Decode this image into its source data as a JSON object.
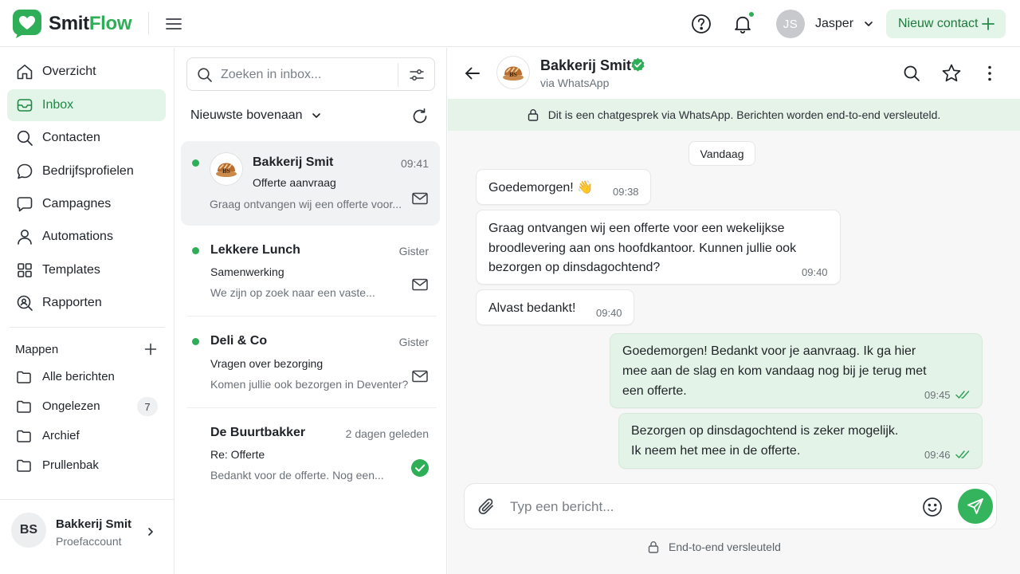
{
  "app": {
    "brand_part1": "Smit",
    "brand_part2": "Flow",
    "brand_color": "#2eae57"
  },
  "topbar": {
    "menu_icon": "hamburger-menu-icon",
    "help_icon": "help-circle-icon",
    "notification_icon": "bell-icon",
    "user_initials": "JS",
    "user_name": "Jasper",
    "new_contact_label": "Nieuw contact"
  },
  "sidebar": {
    "nav": [
      {
        "label": "Overzicht",
        "icon": "home-icon"
      },
      {
        "label": "Inbox",
        "icon": "inbox-icon",
        "active": true
      },
      {
        "label": "Contacten",
        "icon": "search-icon"
      },
      {
        "label": "Bedrijfsprofielen",
        "icon": "chat-bubble-icon"
      },
      {
        "label": "Campagnes",
        "icon": "message-square-icon"
      },
      {
        "label": "Automations",
        "icon": "user-icon"
      },
      {
        "label": "Templates",
        "icon": "grid-icon"
      },
      {
        "label": "Rapporten",
        "icon": "report-icon"
      }
    ],
    "folders_title": "Mappen",
    "folders": [
      {
        "label": "Alle berichten"
      },
      {
        "label": "Ongelezen",
        "count": "7"
      },
      {
        "label": "Archief"
      },
      {
        "label": "Prullenbak"
      }
    ],
    "account": {
      "initials": "BS",
      "name": "Bakkerij Smit",
      "plan": "Proefaccount"
    }
  },
  "inbox": {
    "search_placeholder": "Zoeken in inbox...",
    "sort_label": "Nieuwste bovenaan",
    "conversations": [
      {
        "name": "Bakkerij Smit",
        "time": "09:41",
        "subject": "Offerte aanvraag",
        "preview": "Graag ontvangen wij een offerte voor...",
        "unread": true,
        "status_icon": "mail-icon"
      },
      {
        "name": "Lekkere Lunch",
        "time": "Gister",
        "subject": "Samenwerking",
        "preview": "We zijn op zoek naar een vaste...",
        "unread": true,
        "status_icon": "mail-icon"
      },
      {
        "name": "Deli & Co",
        "time": "Gister",
        "subject": "Vragen over bezorging",
        "preview": "Komen jullie ook bezorgen in Deventer?",
        "unread": true,
        "status_icon": "mail-icon"
      },
      {
        "name": "De Buurtbakker",
        "time": "2 dagen geleden",
        "subject": "Re: Offerte",
        "preview": "Bedankt voor de offerte. Nog een...",
        "unread": false,
        "status_icon": "check-circle-icon"
      }
    ]
  },
  "chat": {
    "contact_name": "Bakkerij Smit",
    "channel": "via WhatsApp",
    "encryption_banner": "Dit is een chatgesprek via WhatsApp. Berichten worden end-to-end versleuteld.",
    "day_label": "Vandaag",
    "messages": [
      {
        "direction": "in",
        "lines": [
          "Goedemorgen! 👋"
        ],
        "time": "09:38"
      },
      {
        "direction": "in",
        "lines": [
          "Graag ontvangen wij een offerte voor een wekelijkse",
          "broodlevering aan ons hoofdkantoor. Kunnen jullie ook",
          "bezorgen op dinsdagochtend?"
        ],
        "time": "09:40"
      },
      {
        "direction": "in",
        "lines": [
          "Alvast bedankt!"
        ],
        "time": "09:40"
      },
      {
        "direction": "out",
        "lines": [
          "Goedemorgen! Bedankt voor je aanvraag. Ik ga hier",
          "mee aan de slag en kom vandaag nog bij je terug met",
          "een offerte."
        ],
        "time": "09:45",
        "read": true
      },
      {
        "direction": "out",
        "lines": [
          "Bezorgen op dinsdagochtend is zeker mogelijk.",
          "Ik neem het mee in de offerte."
        ],
        "time": "09:46",
        "read": true
      }
    ],
    "composer_placeholder": "Typ een bericht...",
    "footer_note": "End-to-end versleuteld"
  }
}
